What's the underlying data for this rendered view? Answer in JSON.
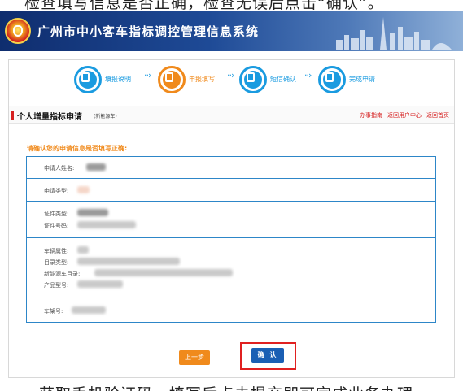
{
  "caption_top": "检查填写信息是否正确，检查无误后点击“确认”。",
  "caption_bottom": "获取手机验证码，填写后点击提交即可完成业务办理。",
  "header": {
    "title": "广州市中小客车指标调控管理信息系统"
  },
  "steps": [
    {
      "label": "填报说明",
      "icon": "document-icon"
    },
    {
      "label": "申报填写",
      "icon": "edit-icon"
    },
    {
      "label": "短信确认",
      "icon": "phone-icon"
    },
    {
      "label": "完成申请",
      "icon": "check-document-icon"
    }
  ],
  "section": {
    "title": "个人增量指标申请",
    "subtitle": "(新能源车)",
    "links": [
      "办事指南",
      "返回用户中心",
      "返回首页"
    ]
  },
  "confirm_prompt": "请确认您的申请信息是否填写正确:",
  "fields": {
    "applicant_name": "申请人姓名:",
    "apply_type": "申请类型:",
    "id_type": "证件类型:",
    "id_number": "证件号码:",
    "vehicle_attr": "车辆属性:",
    "catalog_type": "目录类型:",
    "nev_catalog": "新能源车目录:",
    "product_model": "产品型号:",
    "vin": "车架号:"
  },
  "buttons": {
    "prev": "上一步",
    "confirm": "确 认"
  },
  "colors": {
    "accent_blue": "#1a9be0",
    "accent_orange": "#f08a1c",
    "highlight_red": "#e02020"
  }
}
